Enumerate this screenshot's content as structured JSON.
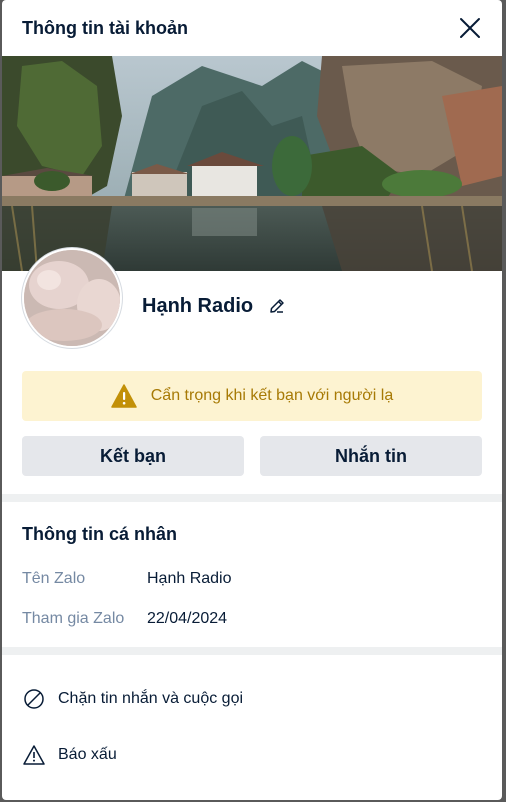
{
  "header": {
    "title": "Thông tin tài khoản",
    "close_icon": "close-icon"
  },
  "profile": {
    "name": "Hạnh Radio",
    "edit_icon": "pencil-icon",
    "avatar_icon": "avatar"
  },
  "warning": {
    "icon": "warning-triangle-icon",
    "text": "Cẩn trọng khi kết bạn với người lạ",
    "color": "#a77a06",
    "background": "#fdf3d1"
  },
  "buttons": {
    "add_friend": "Kết bạn",
    "message": "Nhắn tin"
  },
  "personal_info": {
    "title": "Thông tin cá nhân",
    "rows": [
      {
        "label": "Tên Zalo",
        "value": "Hạnh Radio"
      },
      {
        "label": "Tham gia Zalo",
        "value": "22/04/2024"
      }
    ]
  },
  "actions": [
    {
      "label": "Chặn tin nhắn và cuộc gọi",
      "icon": "block-icon"
    },
    {
      "label": "Báo xấu",
      "icon": "report-warning-icon"
    }
  ],
  "colors": {
    "text_primary": "#081c36",
    "text_secondary": "#7589a3",
    "button_bg": "#e5e7eb",
    "separator": "#eef0f1"
  }
}
